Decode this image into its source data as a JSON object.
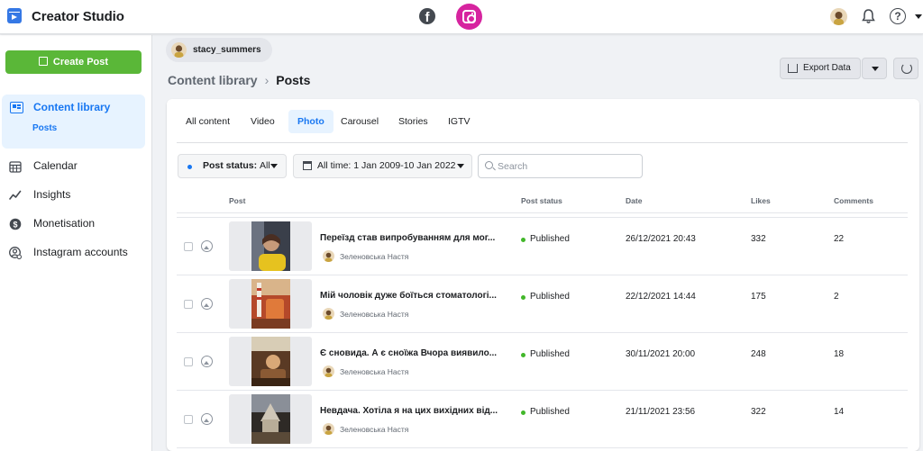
{
  "app": {
    "title": "Creator Studio"
  },
  "header": {
    "fb_icon": "facebook-icon",
    "ig_icon": "instagram-icon",
    "help_glyph": "?"
  },
  "sidebar": {
    "create_label": "Create Post",
    "content_library": {
      "label": "Content library",
      "sub": "Posts"
    },
    "items": [
      {
        "label": "Calendar",
        "icon": "calendar-icon"
      },
      {
        "label": "Insights",
        "icon": "insights-icon"
      },
      {
        "label": "Monetisation",
        "icon": "dollar-icon"
      },
      {
        "label": "Instagram accounts",
        "icon": "accounts-icon"
      }
    ]
  },
  "account": {
    "name": "stacy_summers"
  },
  "breadcrumb": {
    "parent": "Content library",
    "current": "Posts"
  },
  "toolbar": {
    "export_label": "Export Data"
  },
  "tabs": [
    "All content",
    "Video",
    "Photo",
    "Carousel",
    "Stories",
    "IGTV"
  ],
  "active_tab": "Photo",
  "filters": {
    "status_label": "Post status:",
    "status_value": "All",
    "date_label": "All time: 1 Jan 2009-10 Jan 2022",
    "search_placeholder": "Search"
  },
  "table": {
    "headers": {
      "post": "Post",
      "status": "Post status",
      "date": "Date",
      "likes": "Likes",
      "comments": "Comments"
    },
    "rows": [
      {
        "title": "Переїзд став випробуванням для мог...",
        "author": "Зеленовська Настя",
        "status": "Published",
        "date": "26/12/2021 20:43",
        "likes": "332",
        "comments": "22"
      },
      {
        "title": "Мій чоловік дуже боїться стоматологі...",
        "author": "Зеленовська Настя",
        "status": "Published",
        "date": "22/12/2021 14:44",
        "likes": "175",
        "comments": "2"
      },
      {
        "title": "Є сновида. А є сноїжа Вчора виявило...",
        "author": "Зеленовська Настя",
        "status": "Published",
        "date": "30/11/2021 20:00",
        "likes": "248",
        "comments": "18"
      },
      {
        "title": "Невдача. Хотіла я на цих вихідних від...",
        "author": "Зеленовська Настя",
        "status": "Published",
        "date": "21/11/2021 23:56",
        "likes": "322",
        "comments": "14"
      }
    ]
  },
  "colors": {
    "accent": "#1877f2",
    "create": "#5ab738",
    "instagram": "#d6249f",
    "published": "#42b72a"
  }
}
